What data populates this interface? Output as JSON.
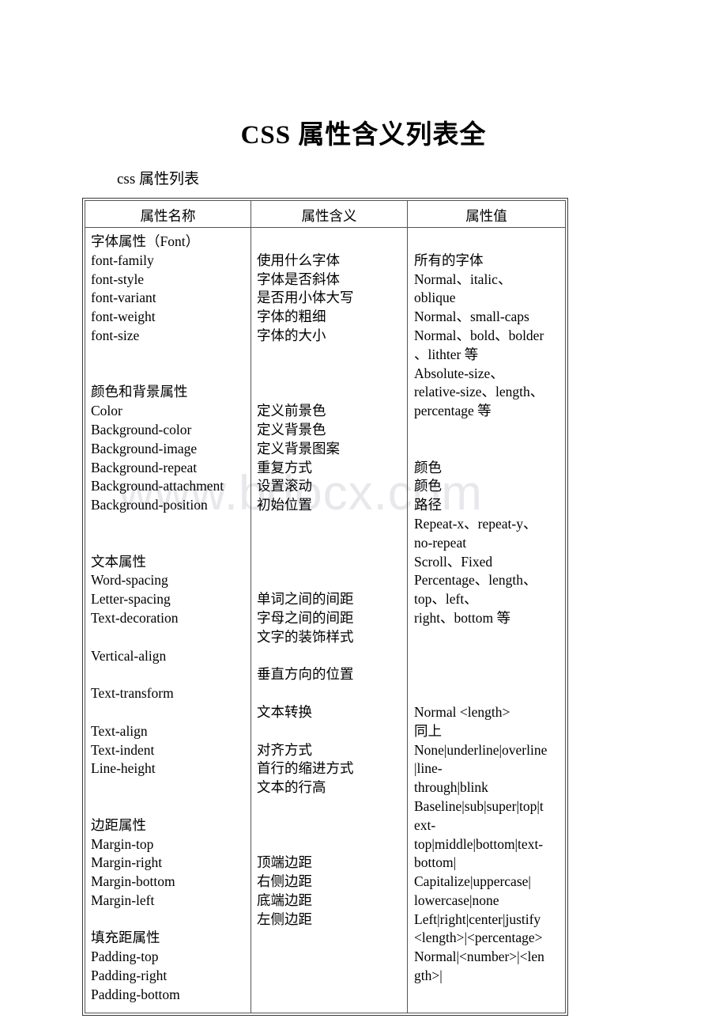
{
  "document": {
    "title": "CSS 属性含义列表全",
    "subtitle": "css 属性列表",
    "watermark": "www.bdocx.com"
  },
  "table": {
    "headers": {
      "col1": "属性名称",
      "col2": "属性含义",
      "col3": "属性值"
    },
    "column1_lines": [
      "字体属性（Font）",
      "font-family",
      "font-style",
      "font-variant",
      "font-weight",
      "font-size",
      "",
      "",
      "颜色和背景属性",
      "Color",
      "Background-color",
      "Background-image",
      "Background-repeat",
      "Background-attachment",
      "Background-position",
      "",
      "",
      "文本属性",
      "Word-spacing",
      "Letter-spacing",
      "Text-decoration",
      "",
      "Vertical-align",
      "",
      "Text-transform",
      "",
      "Text-align",
      "Text-indent",
      "Line-height",
      "",
      "",
      "边距属性",
      "Margin-top",
      "Margin-right",
      "Margin-bottom",
      "Margin-left",
      "",
      "填充距属性",
      "Padding-top",
      "Padding-right",
      "Padding-bottom"
    ],
    "column2_lines": [
      "",
      "使用什么字体",
      "字体是否斜体",
      "是否用小体大写",
      "字体的粗细",
      "字体的大小",
      "",
      "",
      "",
      "定义前景色",
      "定义背景色",
      "定义背景图案",
      "重复方式",
      "设置滚动",
      "初始位置",
      "",
      "",
      "",
      "",
      "单词之间的间距",
      "字母之间的间距",
      "文字的装饰样式",
      "",
      "垂直方向的位置",
      "",
      "文本转换",
      "",
      "对齐方式",
      "首行的缩进方式",
      "文本的行高",
      "",
      "",
      "",
      "顶端边距",
      "右侧边距",
      "底端边距",
      "左侧边距"
    ],
    "column3_lines": [
      "",
      "所有的字体",
      "Normal、italic、",
      "oblique",
      "Normal、small-caps",
      "Normal、bold、bolder",
      "、lithter 等",
      "Absolute-size、",
      "relative-size、length、",
      "percentage 等",
      "",
      "",
      "颜色",
      "颜色",
      "路径",
      "Repeat-x、repeat-y、",
      "no-repeat",
      "Scroll、Fixed",
      "Percentage、length、",
      "top、left、",
      "right、bottom 等",
      "",
      "",
      "",
      "",
      "Normal <length>",
      "同上",
      "None|underline|overline",
      "|line-",
      "through|blink",
      "Baseline|sub|super|top|t",
      "ext-",
      "top|middle|bottom|text-",
      "bottom|",
      "Capitalize|uppercase|",
      "lowercase|none",
      "Left|right|center|justify",
      "<length>|<percentage>",
      "Normal|<number>|<len",
      "gth>|"
    ]
  }
}
